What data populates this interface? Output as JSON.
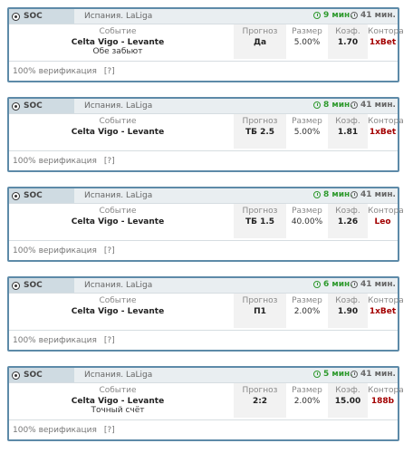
{
  "colors": {
    "border": "#5d8aa8",
    "timer_green": "#2e9a2e",
    "bookmaker_red": "#a30000"
  },
  "icons": {
    "sport": "soccer-ball-icon",
    "timer": "clock-icon"
  },
  "labels": {
    "event": "Событие",
    "pick": "Прогноз",
    "size": "Размер",
    "odds": "Коэф.",
    "bookmaker": "Контора",
    "verification": "100% верификация",
    "help": "[?]"
  },
  "cards": [
    {
      "sport": "SOC",
      "league": "Испания. LaLiga",
      "time_left": "9 мин.",
      "time_total": "41 мин.",
      "match": "Celta Vigo - Levante",
      "note": "Обе забьют",
      "pick": "Да",
      "size": "5.00%",
      "odds": "1.70",
      "bookmaker": "1xBet"
    },
    {
      "sport": "SOC",
      "league": "Испания. LaLiga",
      "time_left": "8 мин.",
      "time_total": "41 мин.",
      "match": "Celta Vigo - Levante",
      "note": "",
      "pick": "ТБ 2.5",
      "size": "5.00%",
      "odds": "1.81",
      "bookmaker": "1xBet"
    },
    {
      "sport": "SOC",
      "league": "Испания. LaLiga",
      "time_left": "8 мин.",
      "time_total": "41 мин.",
      "match": "Celta Vigo - Levante",
      "note": "",
      "pick": "ТБ 1.5",
      "size": "40.00%",
      "odds": "1.26",
      "bookmaker": "Leo"
    },
    {
      "sport": "SOC",
      "league": "Испания. LaLiga",
      "time_left": "6 мин.",
      "time_total": "41 мин.",
      "match": "Celta Vigo - Levante",
      "note": "",
      "pick": "П1",
      "size": "2.00%",
      "odds": "1.90",
      "bookmaker": "1xBet"
    },
    {
      "sport": "SOC",
      "league": "Испания. LaLiga",
      "time_left": "5 мин.",
      "time_total": "41 мин.",
      "match": "Celta Vigo - Levante",
      "note": "Точный счёт",
      "pick": "2:2",
      "size": "2.00%",
      "odds": "15.00",
      "bookmaker": "188b"
    }
  ]
}
